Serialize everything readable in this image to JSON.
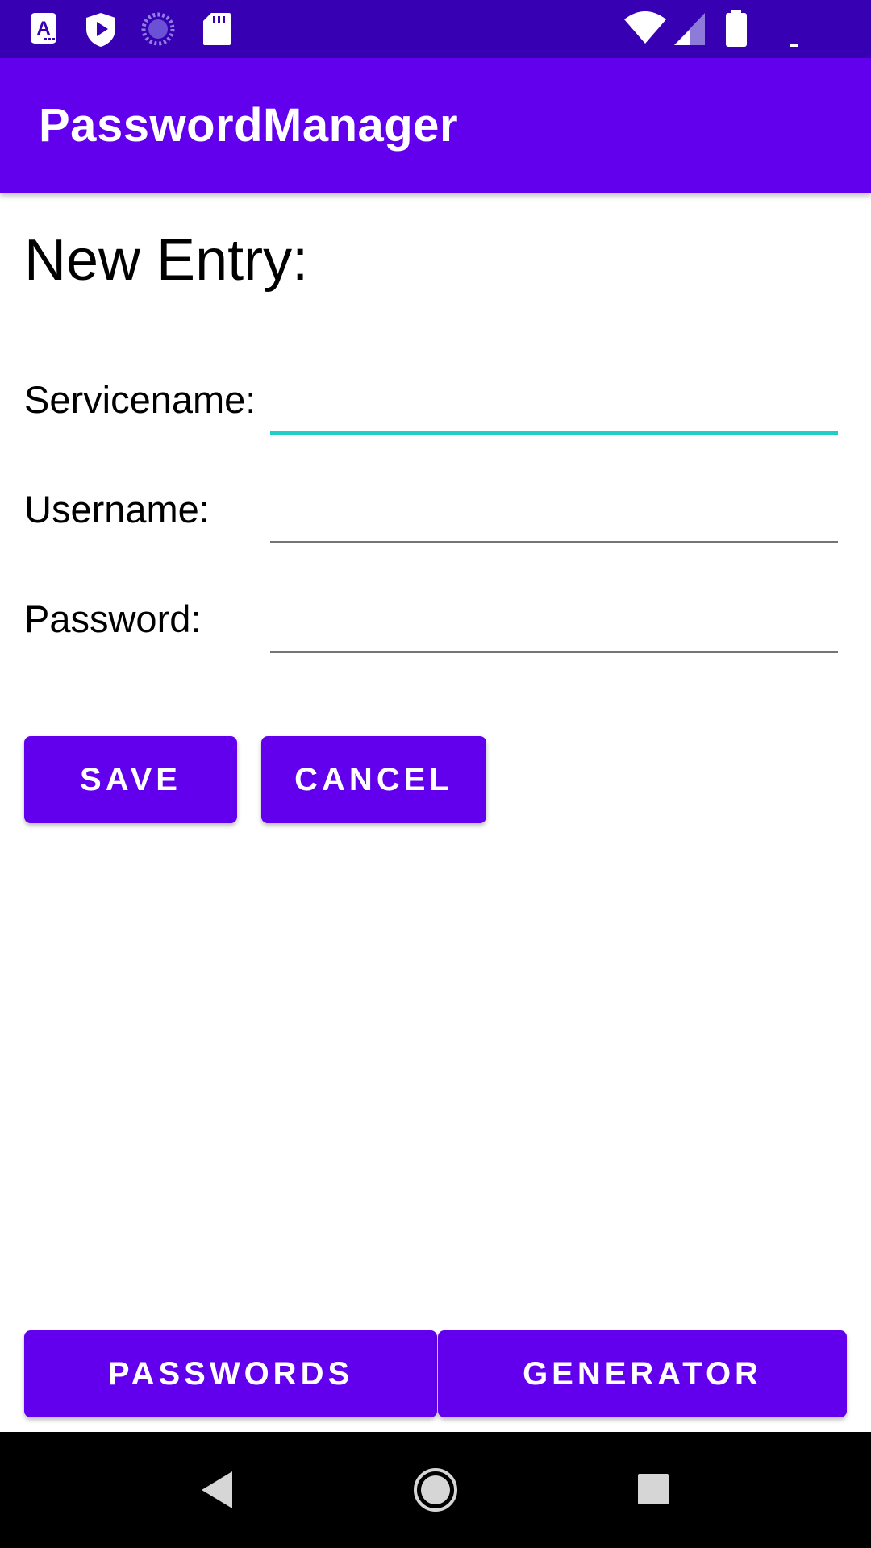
{
  "status_bar": {
    "left_icons": [
      "text-app-icon",
      "play-protect-icon",
      "sync-spinner-icon",
      "sd-card-icon"
    ],
    "right_icons": [
      "wifi-icon",
      "cell-signal-icon",
      "battery-icon"
    ]
  },
  "app_bar": {
    "title": "PasswordManager"
  },
  "form": {
    "heading": "New Entry:",
    "fields": [
      {
        "label": "Servicename:",
        "value": "",
        "placeholder": "",
        "focused": true
      },
      {
        "label": "Username:",
        "value": "",
        "placeholder": "",
        "focused": false
      },
      {
        "label": "Password:",
        "value": "",
        "placeholder": "",
        "focused": false
      }
    ],
    "save_label": "SAVE",
    "cancel_label": "CANCEL"
  },
  "bottom_tabs": {
    "passwords_label": "PASSWORDS",
    "generator_label": "GENERATOR"
  },
  "nav_bar": {
    "icons": [
      "back-icon",
      "home-icon",
      "recents-icon"
    ]
  },
  "colors": {
    "status_bar": "#3700b3",
    "primary": "#6200ee",
    "focus_accent": "#1fcfc7",
    "input_underline": "#757575"
  }
}
